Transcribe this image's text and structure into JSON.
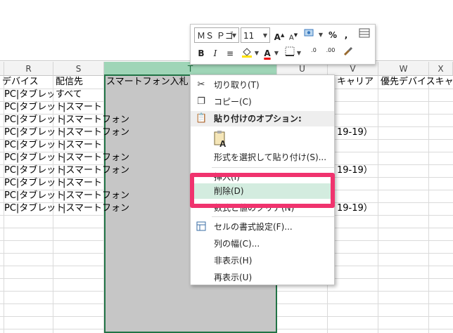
{
  "mini_toolbar": {
    "font_name": "ＭＳ Ｐゴ",
    "font_size": "11",
    "grow_font": "A",
    "shrink_font": "A",
    "percent": "%",
    "comma": ",",
    "bold": "B",
    "italic": "I",
    "font_color": "A",
    "fill_color": "◆",
    "inc_decimal": ".00",
    "dec_decimal": ".0"
  },
  "columns": [
    {
      "id": "R",
      "label": "R"
    },
    {
      "id": "S",
      "label": "S"
    },
    {
      "id": "T",
      "label": "T"
    },
    {
      "id": "U",
      "label": "U"
    },
    {
      "id": "V",
      "label": "V"
    },
    {
      "id": "W",
      "label": "W"
    },
    {
      "id": "X",
      "label": "X"
    }
  ],
  "header_row": {
    "r": "デバイス",
    "s": "配信先",
    "t": "スマートフォン入札",
    "v": "キャリア",
    "w": "優先デバイスキャン"
  },
  "rows": [
    {
      "r": "PC|タブレッ",
      "s": "すべて",
      "v": ""
    },
    {
      "r": "PC|タブレット",
      "s": "|スマート",
      "v": ""
    },
    {
      "r": "PC|タブレット",
      "s": "|スマートフォン",
      "v": ""
    },
    {
      "r": "PC|タブレット",
      "s": "|スマートフォン",
      "v": "19-19）"
    },
    {
      "r": "PC|タブレット",
      "s": "|スマート",
      "v": ""
    },
    {
      "r": "PC|タブレット",
      "s": "|スマートフォン",
      "v": ""
    },
    {
      "r": "PC|タブレット",
      "s": "|スマートフォン",
      "v": "19-19）"
    },
    {
      "r": "PC|タブレット",
      "s": "|スマート",
      "v": ""
    },
    {
      "r": "PC|タブレット",
      "s": "|スマートフォン",
      "v": ""
    },
    {
      "r": "PC|タブレット",
      "s": "|スマートフォン",
      "v": "19-19）"
    }
  ],
  "context_menu": {
    "cut": "切り取り(T)",
    "copy": "コピー(C)",
    "paste_options": "貼り付けのオプション:",
    "paste_special": "形式を選択して貼り付け(S)...",
    "insert": "挿入(I)",
    "delete": "削除(D)",
    "clear_contents": "数式と値のクリア(N)",
    "format_cells": "セルの書式設定(F)...",
    "column_width": "列の幅(C)...",
    "hide": "非表示(H)",
    "unhide": "再表示(U)"
  },
  "colors": {
    "selection_border": "#217346",
    "selection_fill": "#c6c6c6",
    "menu_highlight": "#d3ecdf",
    "annotation": "#f0336e"
  },
  "icons": [
    "scissors-icon",
    "copy-icon",
    "paste-icon",
    "paste-values-icon",
    "format-cells-icon"
  ]
}
